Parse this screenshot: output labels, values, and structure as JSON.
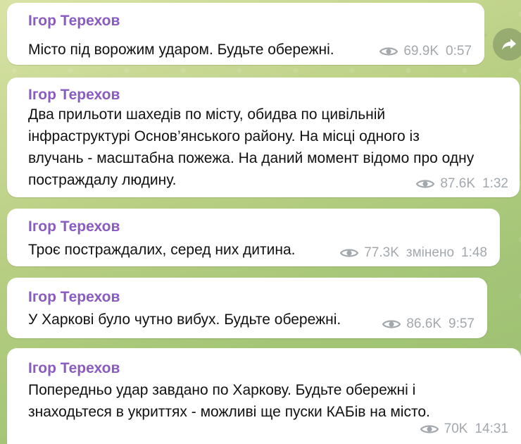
{
  "messages": [
    {
      "author": "Ігор Терехов",
      "text": "Місто під ворожим ударом. Будьте обережні.",
      "views": "69.9K",
      "edited": "",
      "time": "0:57"
    },
    {
      "author": "Ігор Терехов",
      "text": "Два прильоти шахедів по місту, обидва по цивільній\nінфраструктурі Основ’янського району. На місці одного із\nвлучань - масштабна пожежа. На даний момент відомо про одну\nпостраждалу людину.",
      "views": "87.6K",
      "edited": "",
      "time": "1:32"
    },
    {
      "author": "Ігор Терехов",
      "text": "Троє постраждалих, серед них дитина.",
      "views": "77.3K",
      "edited": "змінено",
      "time": "1:48"
    },
    {
      "author": "Ігор Терехов",
      "text": "У Харкові було чутно вибух. Будьте обережні.",
      "views": "86.6K",
      "edited": "",
      "time": "9:57"
    },
    {
      "author": "Ігор Терехов",
      "text": "Попередньо удар завдано по Харкову. Будьте обережні і\nзнаходьтеся в укриттях - можливі ще пуски КАБів на місто.",
      "views": "70K",
      "edited": "",
      "time": "14:31"
    }
  ],
  "icons": {
    "views": "eye-icon",
    "share": "share-arrow-icon"
  },
  "colors": {
    "author": "#8a5bc1",
    "meta": "#a3a8ad",
    "bubble": "#ffffff"
  }
}
